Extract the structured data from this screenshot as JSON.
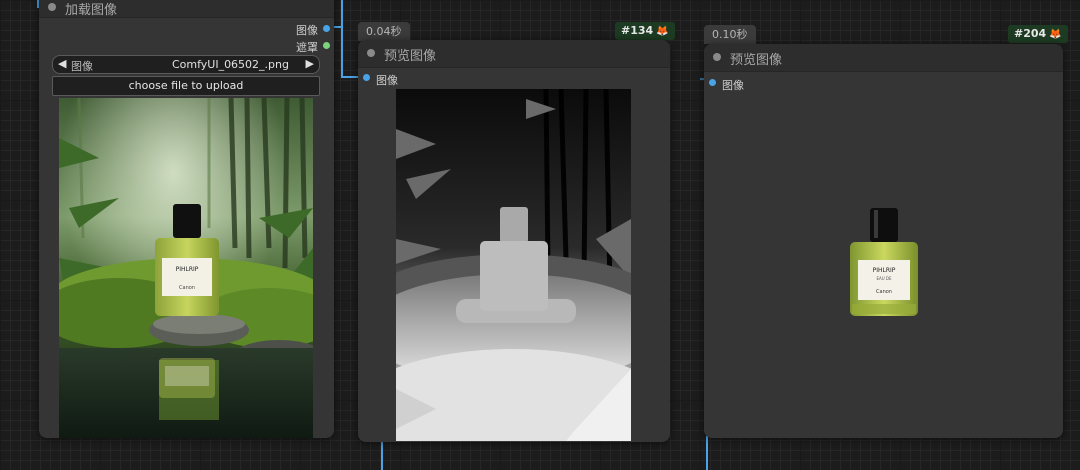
{
  "colors": {
    "image_slot": "#4aa3e6",
    "mask_slot": "#7bd47b",
    "wire": "#4aa3e6",
    "node_bg": "#353535",
    "badge_bg": "#1d3b22",
    "fox_icon": "#ff8a1f"
  },
  "load_node": {
    "title": "加载图像",
    "outputs": [
      "图像",
      "遮罩"
    ],
    "image_widget": {
      "label": "图像",
      "value": "ComfyUI_06502_.png",
      "prev_icon": "triangle-left-icon",
      "next_icon": "triangle-right-icon"
    },
    "upload_label": "choose file to upload",
    "preview_icon": "perfume-scene-image"
  },
  "preview_node_1": {
    "time": "0.04秒",
    "id": "#134",
    "title": "预览图像",
    "input": "图像",
    "preview_icon": "depth-map-image"
  },
  "preview_node_2": {
    "time": "0.10秒",
    "id": "#204",
    "title": "预览图像",
    "input": "图像",
    "preview_icon": "perfume-cutout-image"
  },
  "perfume_label": {
    "brand": "PIHLRIP",
    "sub": "EAU DE",
    "maker": "Canon"
  },
  "icons": {
    "badge_icon": "fox-icon"
  }
}
